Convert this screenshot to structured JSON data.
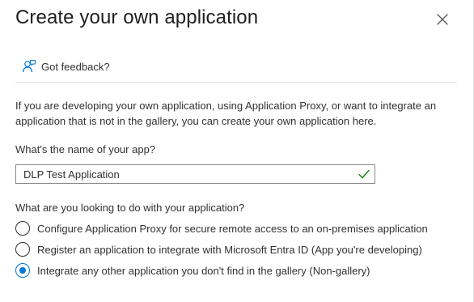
{
  "dialog": {
    "title": "Create your own application",
    "close_icon": "close-icon"
  },
  "feedback": {
    "icon": "feedback-person-icon",
    "label": "Got feedback?"
  },
  "intro_text": "If you are developing your own application, using Application Proxy, or want to integrate an application that is not in the gallery, you can create your own application here.",
  "name_field": {
    "label": "What's the name of your app?",
    "value": "DLP Test Application",
    "status_icon": "checkmark-icon",
    "status_color": "#107c10"
  },
  "purpose": {
    "question": "What are you looking to do with your application?",
    "selected_index": 2,
    "accent_color": "#0078d4",
    "options": [
      {
        "label": "Configure Application Proxy for secure remote access to an on-premises application"
      },
      {
        "label": "Register an application to integrate with Microsoft Entra ID (App you're developing)"
      },
      {
        "label": "Integrate any other application you don't find in the gallery (Non-gallery)"
      }
    ]
  }
}
